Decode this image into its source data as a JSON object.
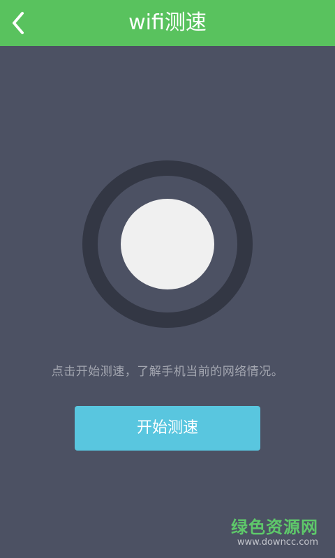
{
  "header": {
    "title": "wifi测速",
    "back_icon": "chevron-left-icon"
  },
  "main": {
    "hint_text": "点击开始测速，了解手机当前的网络情况。",
    "start_button_label": "开始测速"
  },
  "watermark": {
    "title": "绿色资源网",
    "url": "www.downcc.com"
  },
  "colors": {
    "header_bg": "#59c25e",
    "page_bg": "#4c5163",
    "ring": "#333744",
    "dot": "#f0f0f0",
    "button_bg": "#59c6df",
    "hint_text": "#a3a6b0"
  }
}
